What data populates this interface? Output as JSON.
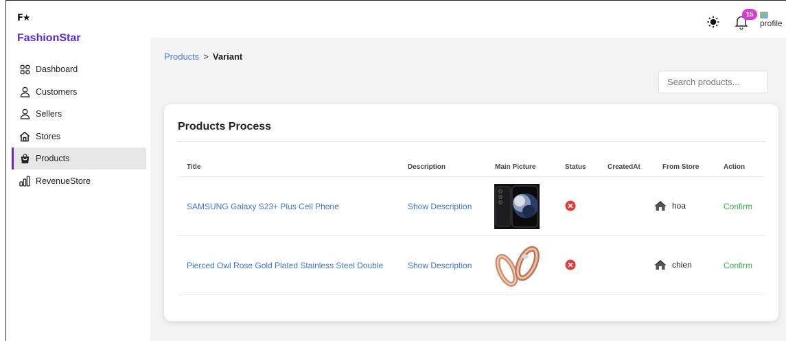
{
  "brand": {
    "logo_text": "F★",
    "name": "FashionStar"
  },
  "sidebar": {
    "items": [
      {
        "label": "Dashboard",
        "icon": "grid-icon",
        "active": false
      },
      {
        "label": "Customers",
        "icon": "user-icon",
        "active": false
      },
      {
        "label": "Sellers",
        "icon": "user-icon",
        "active": false
      },
      {
        "label": "Stores",
        "icon": "home-icon",
        "active": false
      },
      {
        "label": "Products",
        "icon": "shopping-bag-icon",
        "active": true
      },
      {
        "label": "RevenueStore",
        "icon": "bar-chart-icon",
        "active": false
      }
    ]
  },
  "header": {
    "notification_count": "15",
    "profile_alt": "profile"
  },
  "breadcrumb": {
    "parent": "Products",
    "separator": ">",
    "current": "Variant"
  },
  "search": {
    "placeholder": "Search products...",
    "value": ""
  },
  "card": {
    "title": "Products Process",
    "columns": [
      "Title",
      "Description",
      "Main Picture",
      "Status",
      "CreatedAt",
      "From Store",
      "Action"
    ],
    "rows": [
      {
        "title": "SAMSUNG Galaxy S23+ Plus Cell Phone",
        "description": "Show Description",
        "picture": "phone",
        "status": "rejected",
        "created_at": "",
        "store": "hoa",
        "action": "Confirm"
      },
      {
        "title": "Pierced Owl Rose Gold Plated Stainless Steel Double",
        "description": "Show Description",
        "picture": "rings",
        "status": "rejected",
        "created_at": "",
        "store": "chien",
        "action": "Confirm"
      }
    ]
  },
  "colors": {
    "brand": "#5b2ad6",
    "active_bar": "#6b21d8",
    "link": "#3b78d6",
    "confirm": "#3cb043",
    "status_error": "#e03a3a",
    "badge": "#d63bd6"
  }
}
